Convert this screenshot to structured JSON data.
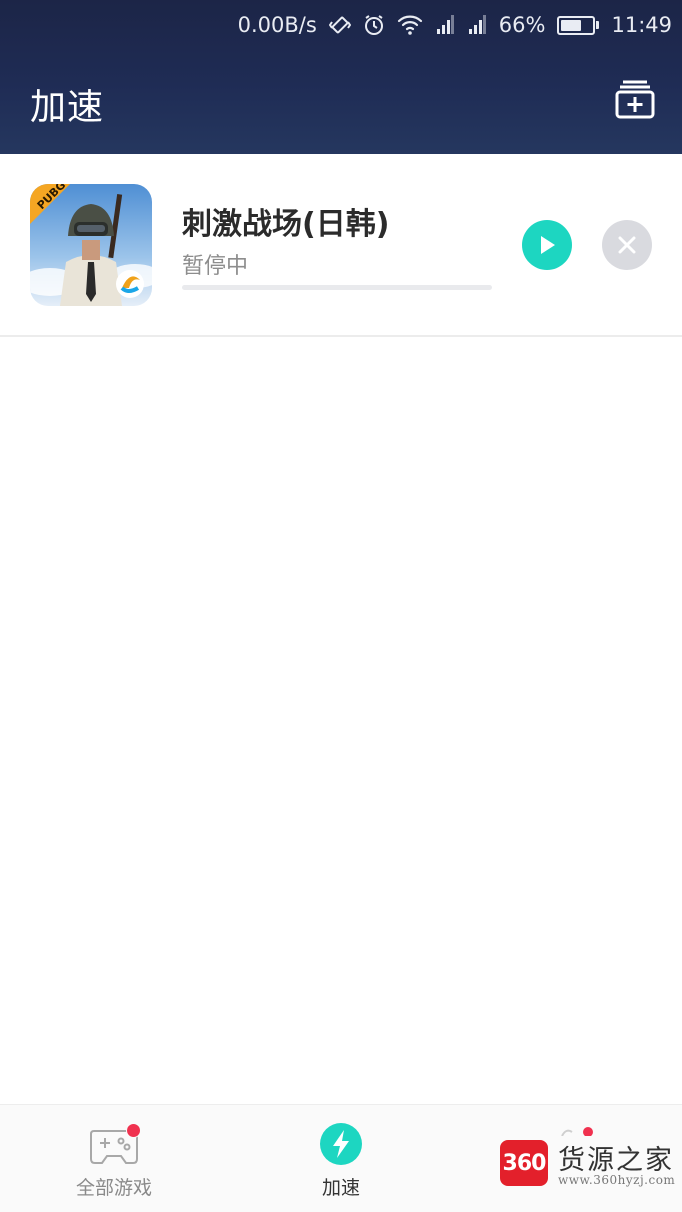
{
  "status_bar": {
    "net_speed": "0.00B/s",
    "battery": "66%",
    "battery_level": 0.66,
    "time": "11:49",
    "icons": [
      "vibrate-icon",
      "alarm-icon",
      "wifi-icon",
      "signal-icon",
      "signal-icon",
      "battery-icon"
    ]
  },
  "header": {
    "title": "加速",
    "add_icon": "add-game-icon"
  },
  "game": {
    "name": "刺激战场(日韩)",
    "status": "暂停中",
    "progress": 0,
    "icon_text": "PUBG",
    "play_icon": "play-icon",
    "close_icon": "close-icon"
  },
  "tabs": [
    {
      "label": "全部游戏",
      "icon": "gamepad-icon",
      "badge": true
    },
    {
      "label": "加速",
      "icon": "bolt-icon",
      "active": true
    }
  ],
  "watermark": {
    "logo": "360",
    "name": "货源之家",
    "url": "www.360hyzj.com"
  },
  "colors": {
    "header": "#1f2c55",
    "accent": "#1dd6c1",
    "badge": "#f0314f",
    "close": "#d9dadf"
  }
}
